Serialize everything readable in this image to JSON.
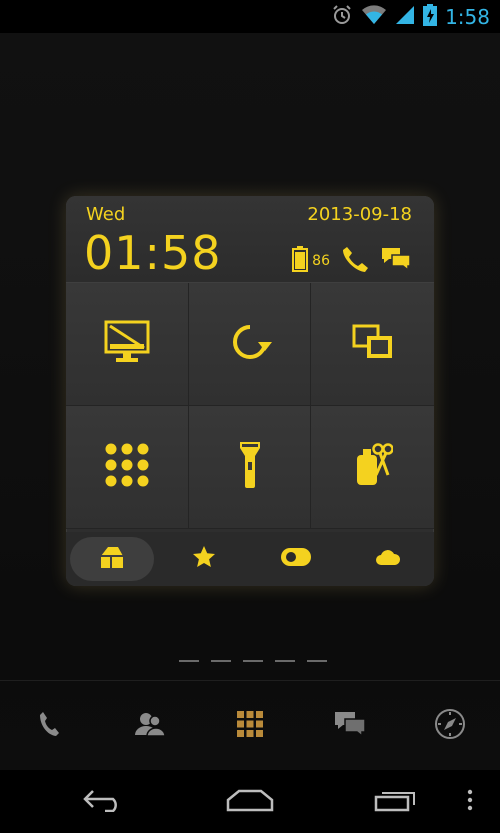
{
  "status_bar": {
    "time": "1:58",
    "icons": [
      "alarm-icon",
      "wifi-icon",
      "signal-icon",
      "battery-charging-icon"
    ]
  },
  "widget": {
    "day": "Wed",
    "date": "2013-09-18",
    "clock": "01:58",
    "battery_percent": "86",
    "status_icons": [
      "battery-icon",
      "phone-icon",
      "messages-icon"
    ],
    "toggles": [
      {
        "name": "screen-toggle",
        "icon": "monitor-icon"
      },
      {
        "name": "rotation-toggle",
        "icon": "rotate-icon"
      },
      {
        "name": "windows-toggle",
        "icon": "windows-icon"
      },
      {
        "name": "apps-toggle",
        "icon": "app-grid-icon"
      },
      {
        "name": "flashlight-toggle",
        "icon": "flashlight-icon"
      },
      {
        "name": "tools-toggle",
        "icon": "scissors-bottle-icon"
      }
    ],
    "tabs": [
      {
        "name": "home-tab",
        "icon": "home-icon",
        "active": true
      },
      {
        "name": "favorites-tab",
        "icon": "star-icon",
        "active": false
      },
      {
        "name": "switches-tab",
        "icon": "switch-icon",
        "active": false
      },
      {
        "name": "weather-tab",
        "icon": "cloud-icon",
        "active": false
      }
    ],
    "accent_color": "#f4d21f"
  },
  "home_pages": {
    "count": 5
  },
  "dock": [
    "phone-icon",
    "people-icon",
    "app-drawer-icon",
    "messaging-icon",
    "browser-icon"
  ],
  "nav_bar": [
    "back-icon",
    "home-icon",
    "recent-apps-icon",
    "overflow-menu-icon"
  ]
}
